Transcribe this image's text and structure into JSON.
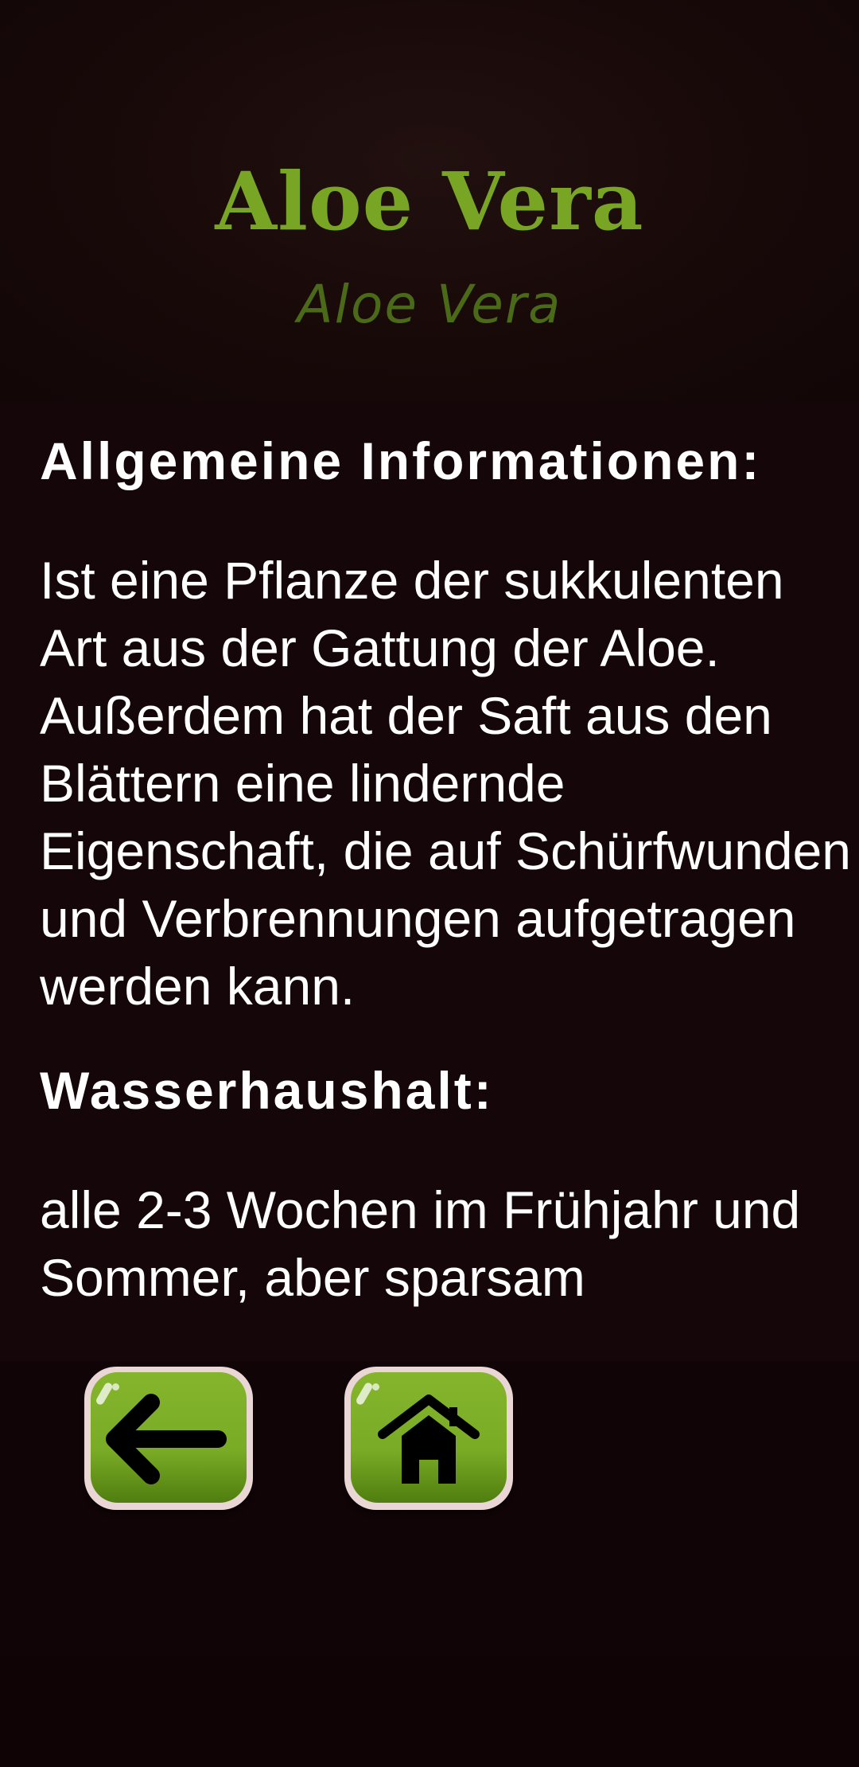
{
  "page": {
    "title": "Aloe Vera",
    "subtitle": "Aloe Vera"
  },
  "sections": [
    {
      "heading": "Allgemeine Informationen:",
      "text": "Ist eine Pflanze der sukkulenten Art aus der Gattung der Aloe. Außerdem hat der Saft aus den Blättern eine lindernde Eigenschaft, die auf Schürfwunden und Verbrennungen aufgetragen werden kann."
    },
    {
      "heading": "Wasserhaushalt:",
      "text": "alle 2-3 Wochen im Frühjahr und Sommer, aber sparsam"
    }
  ],
  "nav": {
    "back_icon": "arrow-left-icon",
    "home_icon": "home-icon"
  },
  "colors": {
    "title": "#78a624",
    "subtitle": "#4a6a18",
    "button_green": "#7aab26",
    "button_border": "#ead6d4",
    "background": "#140609"
  }
}
